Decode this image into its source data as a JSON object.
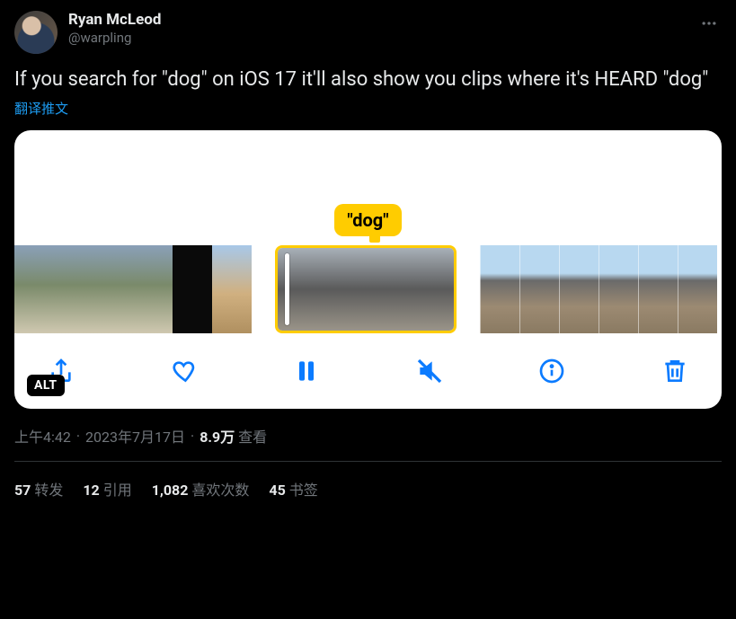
{
  "author": {
    "display_name": "Ryan McLeod",
    "handle": "@warpling"
  },
  "body": "If you search for \"dog\" on iOS 17 it'll also show you clips where it's HEARD \"dog\"",
  "translate_label": "翻译推文",
  "media": {
    "bubble_text": "\"dog\"",
    "alt_badge": "ALT",
    "toolbar_icons": [
      "share",
      "heart",
      "pause",
      "mute",
      "info",
      "trash"
    ]
  },
  "meta": {
    "time": "上午4:42",
    "dot1": "·",
    "date": "2023年7月17日",
    "dot2": "·",
    "views_num": "8.9万",
    "views_label": " 查看"
  },
  "stats": {
    "retweets_num": "57",
    "retweets_label": "转发",
    "quotes_num": "12",
    "quotes_label": "引用",
    "likes_num": "1,082",
    "likes_label": "喜欢次数",
    "bookmarks_num": "45",
    "bookmarks_label": "书签"
  }
}
